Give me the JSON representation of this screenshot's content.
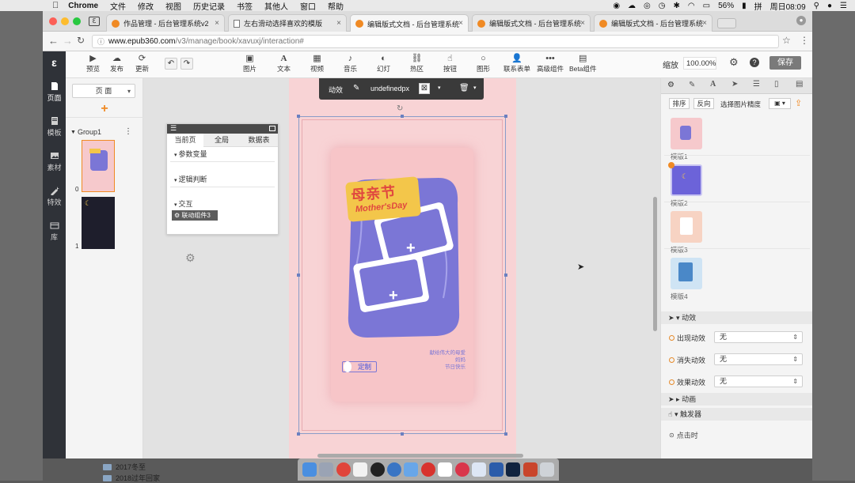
{
  "menubar": {
    "apple": "",
    "items": [
      "Chrome",
      "文件",
      "修改",
      "视图",
      "历史记录",
      "书签",
      "其他人",
      "窗口",
      "帮助"
    ],
    "battery": "56%",
    "clock": "周日08:09"
  },
  "browser": {
    "tabs": [
      {
        "label": "作品管理 - 后台管理系统v2",
        "type": "brand"
      },
      {
        "label": "左右滑动选择喜欢的模版",
        "type": "doc"
      },
      {
        "label": "编辑版式文档 - 后台管理系统",
        "type": "brand",
        "active": true
      },
      {
        "label": "编辑版式文档 - 后台管理系统",
        "type": "brand"
      },
      {
        "label": "编辑版式文档 - 后台管理系统",
        "type": "brand"
      }
    ],
    "url_host": "www.epub360.com",
    "url_path": "/v3/manage/book/xavuxj/interaction#"
  },
  "app": {
    "logo": "ε",
    "leftnav": [
      "页面",
      "模板",
      "素材",
      "特效",
      "库"
    ],
    "toolbar": {
      "preview": "预览",
      "publish": "发布",
      "update": "更新",
      "tools": [
        "图片",
        "文本",
        "视频",
        "音乐",
        "幻灯",
        "热区",
        "按钮",
        "图形",
        "联系表单",
        "高级组件",
        "Beta组件"
      ],
      "zoom_label": "缩放",
      "zoom_value": "100.00%",
      "save": "保存"
    },
    "pagepanel": {
      "dropdown": "页 面",
      "add": "+",
      "group": "Group1",
      "pages": [
        "0",
        "1"
      ]
    },
    "floating_toolbar": {
      "effect": "动效",
      "size": "undefinedpx"
    },
    "interaction_panel": {
      "tabs": [
        "当前页",
        "全局",
        "数据表"
      ],
      "sections": [
        "参数变量",
        "逻辑判断",
        "交互"
      ],
      "component_tag": "联动组件3"
    },
    "poster": {
      "title_cn": "母亲节",
      "title_en": "Mother'sDay",
      "plus": "+",
      "blessing_lines": [
        "献给伟大的母爱",
        "妈妈",
        "节日快乐"
      ],
      "button": "定制"
    },
    "rightpanel": {
      "subtabs": [
        "排序",
        "反向",
        "选择图片精度"
      ],
      "templates": [
        "模版1",
        "模版2",
        "模版3",
        "模版4"
      ],
      "effects_header": "动效",
      "effects": [
        {
          "label": "出现动效",
          "value": "无"
        },
        {
          "label": "消失动效",
          "value": "无"
        },
        {
          "label": "效果动效",
          "value": "无"
        }
      ],
      "animation": "动画",
      "trigger": "触发器",
      "on_click": "点击时"
    }
  },
  "desktop": {
    "folders": [
      "2017冬至",
      "2018过年回家"
    ]
  },
  "colors": {
    "accent_orange": "#e58a2a",
    "poster_pink": "#f6c9cc",
    "poster_purple": "#7b76d6",
    "title_yellow": "#f3c64a",
    "nav_dark": "#2f3238"
  }
}
